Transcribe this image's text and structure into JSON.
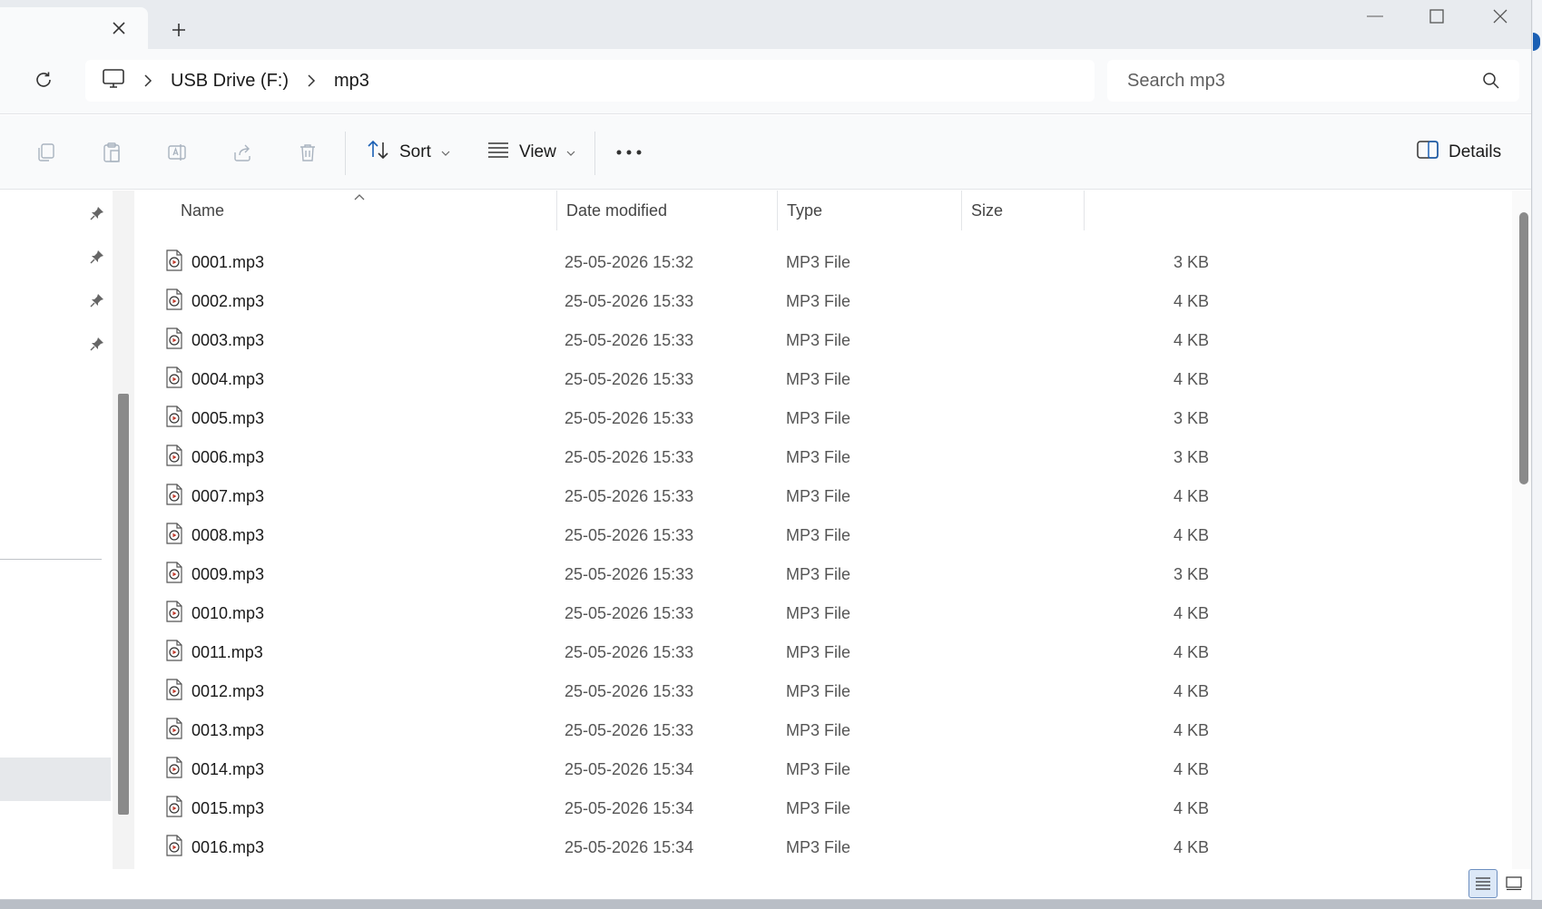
{
  "titlebar": {
    "tab_close_icon": "close-icon",
    "new_tab_icon": "plus-icon"
  },
  "address": {
    "crumbs": [
      "USB Drive (F:)",
      "mp3"
    ]
  },
  "search": {
    "placeholder": "Search mp3"
  },
  "toolbar": {
    "sort_label": "Sort",
    "view_label": "View",
    "details_label": "Details"
  },
  "columns": {
    "name": "Name",
    "date": "Date modified",
    "type": "Type",
    "size": "Size"
  },
  "files": [
    {
      "name": "0001.mp3",
      "date": "25-05-2026 15:32",
      "type": "MP3 File",
      "size": "3 KB"
    },
    {
      "name": "0002.mp3",
      "date": "25-05-2026 15:33",
      "type": "MP3 File",
      "size": "4 KB"
    },
    {
      "name": "0003.mp3",
      "date": "25-05-2026 15:33",
      "type": "MP3 File",
      "size": "4 KB"
    },
    {
      "name": "0004.mp3",
      "date": "25-05-2026 15:33",
      "type": "MP3 File",
      "size": "4 KB"
    },
    {
      "name": "0005.mp3",
      "date": "25-05-2026 15:33",
      "type": "MP3 File",
      "size": "3 KB"
    },
    {
      "name": "0006.mp3",
      "date": "25-05-2026 15:33",
      "type": "MP3 File",
      "size": "3 KB"
    },
    {
      "name": "0007.mp3",
      "date": "25-05-2026 15:33",
      "type": "MP3 File",
      "size": "4 KB"
    },
    {
      "name": "0008.mp3",
      "date": "25-05-2026 15:33",
      "type": "MP3 File",
      "size": "4 KB"
    },
    {
      "name": "0009.mp3",
      "date": "25-05-2026 15:33",
      "type": "MP3 File",
      "size": "3 KB"
    },
    {
      "name": "0010.mp3",
      "date": "25-05-2026 15:33",
      "type": "MP3 File",
      "size": "4 KB"
    },
    {
      "name": "0011.mp3",
      "date": "25-05-2026 15:33",
      "type": "MP3 File",
      "size": "4 KB"
    },
    {
      "name": "0012.mp3",
      "date": "25-05-2026 15:33",
      "type": "MP3 File",
      "size": "4 KB"
    },
    {
      "name": "0013.mp3",
      "date": "25-05-2026 15:33",
      "type": "MP3 File",
      "size": "4 KB"
    },
    {
      "name": "0014.mp3",
      "date": "25-05-2026 15:34",
      "type": "MP3 File",
      "size": "4 KB"
    },
    {
      "name": "0015.mp3",
      "date": "25-05-2026 15:34",
      "type": "MP3 File",
      "size": "4 KB"
    },
    {
      "name": "0016.mp3",
      "date": "25-05-2026 15:34",
      "type": "MP3 File",
      "size": "4 KB"
    }
  ],
  "colors": {
    "accent": "#1a5fb4",
    "selected_view": "#dce8f7"
  }
}
